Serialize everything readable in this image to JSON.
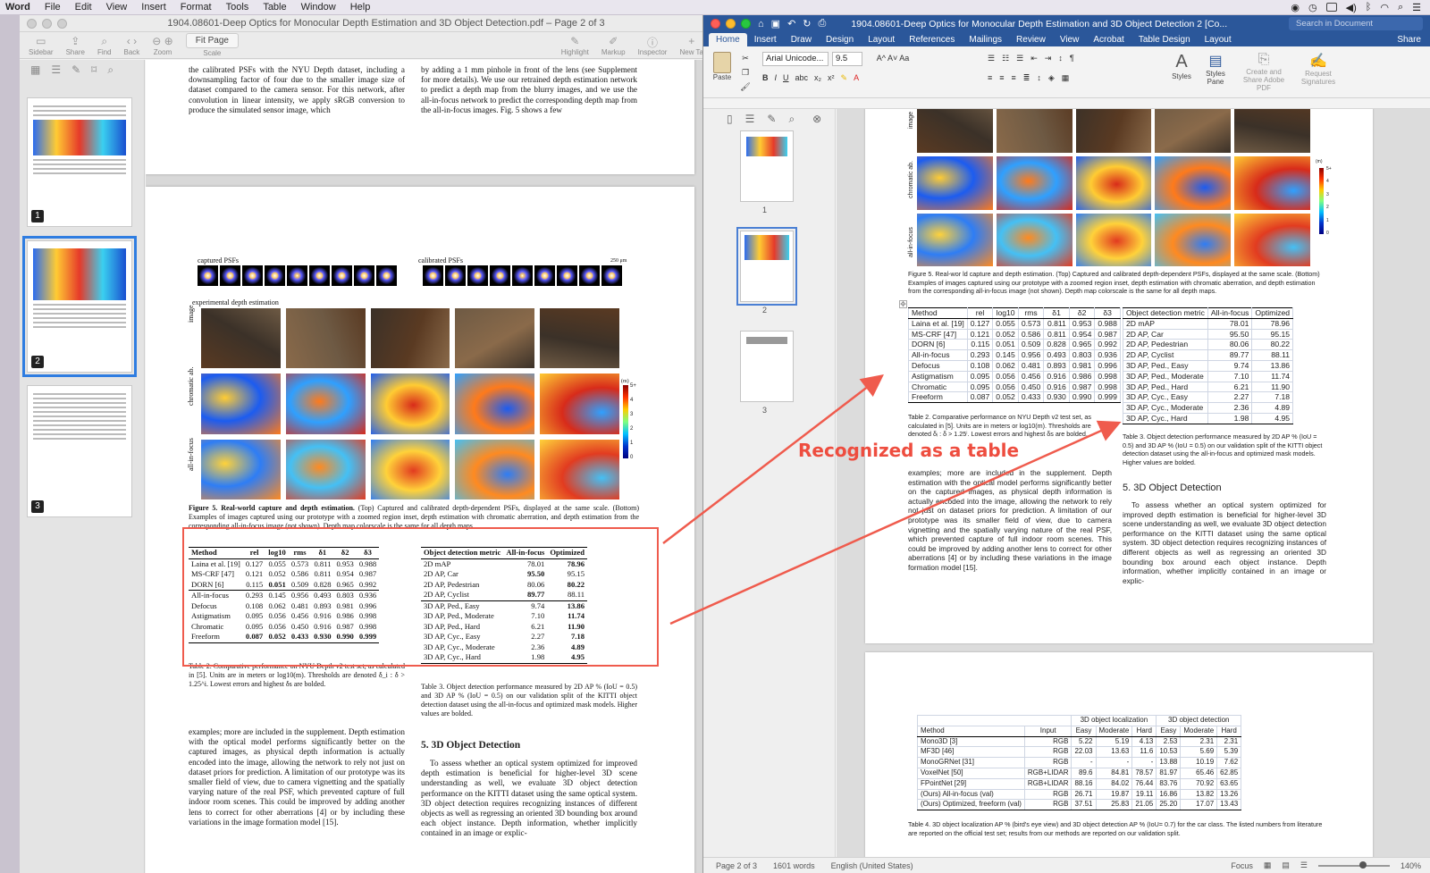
{
  "menubar": {
    "app": "Word",
    "items": [
      "File",
      "Edit",
      "View",
      "Insert",
      "Format",
      "Tools",
      "Table",
      "Window",
      "Help"
    ]
  },
  "preview": {
    "title": "1904.08601-Deep Optics for Monocular Depth Estimation and 3D Object Detection.pdf – Page 2 of 3",
    "toolbar": {
      "sidebar": "Sidebar",
      "share": "Share",
      "find": "Find",
      "back": "Back",
      "zoom": "Zoom",
      "scale": "Scale",
      "fit": "Fit Page",
      "highlight": "Highlight",
      "markup": "Markup",
      "inspector": "Inspector",
      "new_tab": "New Ta"
    },
    "thumbs": [
      "1",
      "2",
      "3"
    ],
    "top_col1": "the calibrated PSFs with the NYU Depth dataset, including a downsampling factor of four due to the smaller image size of dataset compared to the camera sensor. For this network, after convolution in linear intensity, we apply sRGB conversion to produce the simulated sensor image, which",
    "top_col2": "by adding a 1 mm pinhole in front of the lens (see Supplement for more details). We use our retrained depth estimation network to predict a depth map from the blurry images, and we use the all-in-focus network to predict the corresponding depth map from the all-in-focus images. Fig. 5 shows a few",
    "fig_labels": {
      "captured": "captured PSFs",
      "calibrated": "calibrated PSFs",
      "scalebar": "250 μm",
      "experimental": "experimental depth estimation",
      "row_image": "image",
      "row_chrom": "chromatic ab.",
      "row_aif": "all-in-focus",
      "unit": "(m)",
      "cbar_ticks": [
        "5+",
        "4",
        "3",
        "2",
        "1",
        "0"
      ],
      "psf_dists": [
        "0.6 m",
        "0.7 m",
        "0.8 m",
        "0.9 m",
        "1.0 m",
        "1.3 m",
        "1.6 m",
        "2.3 m",
        "3.7 m"
      ]
    },
    "fig5_caption_bold": "Figure 5. Real-world capture and depth estimation.",
    "fig5_caption": "(Top) Captured and calibrated depth-dependent PSFs, displayed at the same scale. (Bottom) Examples of images captured using our prototype with a zoomed region inset, depth estimation with chromatic aberration, and depth estimation from the corresponding all-in-focus image (not shown). Depth map colorscale is the same for all depth maps.",
    "table2_caption": "Table 2. Comparative performance on NYU Depth v2 test set, as calculated in [5]. Units are in meters or log10(m). Thresholds are denoted δ_i : δ > 1.25^i. Lowest errors and highest δs are bolded.",
    "table3_caption": "Table 3. Object detection performance measured by 2D AP % (IoU = 0.5) and 3D AP % (IoU = 0.5) on our validation split of the KITTI object detection dataset using the all-in-focus and optimized mask models. Higher values are bolded.",
    "body_left": "examples; more are included in the supplement. Depth estimation with the optical model performs significantly better on the captured images, as physical depth information is actually encoded into the image, allowing the network to rely not just on dataset priors for prediction. A limitation of our prototype was its smaller field of view, due to camera vignetting and the spatially varying nature of the real PSF, which prevented capture of full indoor room scenes. This could be improved by adding another lens to correct for other aberrations [4] or by including these variations in the image formation model [15].",
    "section_title": "5. 3D Object Detection",
    "body_right": "To assess whether an optical system optimized for improved depth estimation is beneficial for higher-level 3D scene understanding as well, we evaluate 3D object detection performance on the KITTI dataset using the same optical system. 3D object detection requires recognizing instances of different objects as well as regressing an oriented 3D bounding box around each object instance. Depth information, whether implicitly contained in an image or explic-"
  },
  "table2": {
    "headers": [
      "Method",
      "rel",
      "log10",
      "rms",
      "δ1",
      "δ2",
      "δ3"
    ],
    "rows": [
      [
        "Laina et al. [19]",
        "0.127",
        "0.055",
        "0.573",
        "0.811",
        "0.953",
        "0.988"
      ],
      [
        "MS-CRF [47]",
        "0.121",
        "0.052",
        "0.586",
        "0.811",
        "0.954",
        "0.987"
      ],
      [
        "DORN [6]",
        "0.115",
        "0.051",
        "0.509",
        "0.828",
        "0.965",
        "0.992"
      ],
      [
        "All-in-focus",
        "0.293",
        "0.145",
        "0.956",
        "0.493",
        "0.803",
        "0.936"
      ],
      [
        "Defocus",
        "0.108",
        "0.062",
        "0.481",
        "0.893",
        "0.981",
        "0.996"
      ],
      [
        "Astigmatism",
        "0.095",
        "0.056",
        "0.456",
        "0.916",
        "0.986",
        "0.998"
      ],
      [
        "Chromatic",
        "0.095",
        "0.056",
        "0.450",
        "0.916",
        "0.987",
        "0.998"
      ],
      [
        "Freeform",
        "0.087",
        "0.052",
        "0.433",
        "0.930",
        "0.990",
        "0.999"
      ]
    ]
  },
  "table3": {
    "headers": [
      "Object detection metric",
      "All-in-focus",
      "Optimized"
    ],
    "rows": [
      [
        "2D mAP",
        "78.01",
        "78.96"
      ],
      [
        "2D AP, Car",
        "95.50",
        "95.15"
      ],
      [
        "2D AP, Pedestrian",
        "80.06",
        "80.22"
      ],
      [
        "2D AP, Cyclist",
        "89.77",
        "88.11"
      ],
      [
        "3D AP, Ped., Easy",
        "9.74",
        "13.86"
      ],
      [
        "3D AP, Ped., Moderate",
        "7.10",
        "11.74"
      ],
      [
        "3D AP, Ped., Hard",
        "6.21",
        "11.90"
      ],
      [
        "3D AP, Cyc., Easy",
        "2.27",
        "7.18"
      ],
      [
        "3D AP, Cyc., Moderate",
        "2.36",
        "4.89"
      ],
      [
        "3D AP, Cyc., Hard",
        "1.98",
        "4.95"
      ]
    ]
  },
  "word": {
    "title": "1904.08601-Deep Optics for Monocular Depth Estimation and 3D Object Detection 2 [Co...",
    "search_placeholder": "Search in Document",
    "tabs": [
      "Home",
      "Insert",
      "Draw",
      "Design",
      "Layout",
      "References",
      "Mailings",
      "Review",
      "View",
      "Acrobat",
      "Table Design",
      "Layout"
    ],
    "share": "Share",
    "ribbon": {
      "paste": "Paste",
      "font": "Arial Unicode...",
      "size": "9.5",
      "styles": "Styles",
      "styles_pane": "Styles Pane",
      "adobe": "Create and Share Adobe PDF",
      "signatures": "Request Signatures"
    },
    "nav_pages": [
      "1",
      "2",
      "3"
    ],
    "fig5_caption": "Figure 5. Real-wor ld capture and depth estimation. (Top) Captured and calibrated depth-dependent PSFs, displayed at the same scale. (Bottom) Examples of images captured using our prototype with a zoomed region inset, depth estimation with chromatic aberration, and depth estimation from the corresponding all-in-focus image (not shown). Depth map colorscale is the same for all depth maps.",
    "table2_caption": "Table 2. Comparative performance on NYU Depth v2 test set, as calculated in [5]. Units are in meters or log10(m). Thresholds are denoted δᵢ : δ > 1.25ⁱ. Lowest errors and highest δs are bolded.",
    "table3_caption": "Table 3. Object detection performance measured by 2D AP % (IoU = 0.5) and 3D AP % (IoU = 0.5) on our validation split of the KITTI object detection dataset using the all-in-focus and optimized mask models. Higher values are bolded.",
    "body_left": "examples; more are included in the supplement. Depth estimation with the optical model performs significantly better on the captured images, as physical depth information is actually encoded into the image, allowing the network to rely not just on dataset priors for prediction. A limitation of our prototype was its smaller field of view, due to camera vignetting and the spatially varying nature of the real PSF, which prevented capture of full indoor room scenes. This could be improved by adding another lens to correct for other aberrations [4] or by including these variations in the image formation model [15].",
    "section_title": "5. 3D Object Detection",
    "body_right": "To assess whether an optical system optimized for improved depth estimation is beneficial for higher-level 3D scene understanding as well, we evaluate 3D object detection performance on the KITTI dataset using the same optical system. 3D object detection requires recognizing instances of different objects as well as regressing an oriented 3D bounding box around each object instance. Depth information, whether implicitly contained in an image or explic-",
    "table4": {
      "group1": "3D object localization",
      "group2": "3D object detection",
      "headers": [
        "Method",
        "Input",
        "Easy",
        "Moderate",
        "Hard",
        "Easy",
        "Moderate",
        "Hard"
      ],
      "rows": [
        [
          "Mono3D [3]",
          "RGB",
          "5.22",
          "5.19",
          "4.13",
          "2.53",
          "2.31",
          "2.31"
        ],
        [
          "MF3D [46]",
          "RGB",
          "22.03",
          "13.63",
          "11.6",
          "10.53",
          "5.69",
          "5.39"
        ],
        [
          "MonoGRNet [31]",
          "RGB",
          "-",
          "-",
          "-",
          "13.88",
          "10.19",
          "7.62"
        ],
        [
          "VoxelNet [50]",
          "RGB+LIDAR",
          "89.6",
          "84.81",
          "78.57",
          "81.97",
          "65.46",
          "62.85"
        ],
        [
          "FPointNet [29]",
          "RGB+LIDAR",
          "88.16",
          "84.02",
          "76.44",
          "83.76",
          "70.92",
          "63.65"
        ],
        [
          "(Ours) All-in-focus (val)",
          "RGB",
          "26.71",
          "19.87",
          "19.11",
          "16.86",
          "13.82",
          "13.26"
        ],
        [
          "(Ours) Optimized, freeform (val)",
          "RGB",
          "37.51",
          "25.83",
          "21.05",
          "25.20",
          "17.07",
          "13.43"
        ]
      ],
      "caption": "Table 4. 3D object localization AP % (bird's eye view) and 3D object detection AP % (IoU= 0.7) for the car class. The listed numbers from literature are reported on the official test set; results from our methods are reported on our validation split."
    },
    "status": {
      "page": "Page 2 of 3",
      "words": "1601 words",
      "lang": "English (United States)",
      "focus": "Focus",
      "zoom": "140%"
    }
  },
  "annotation": "Recognized as a table",
  "colors": {
    "word_blue": "#2b579a",
    "annot_red": "#ef5b4d",
    "selection_blue": "#2f7de1"
  }
}
